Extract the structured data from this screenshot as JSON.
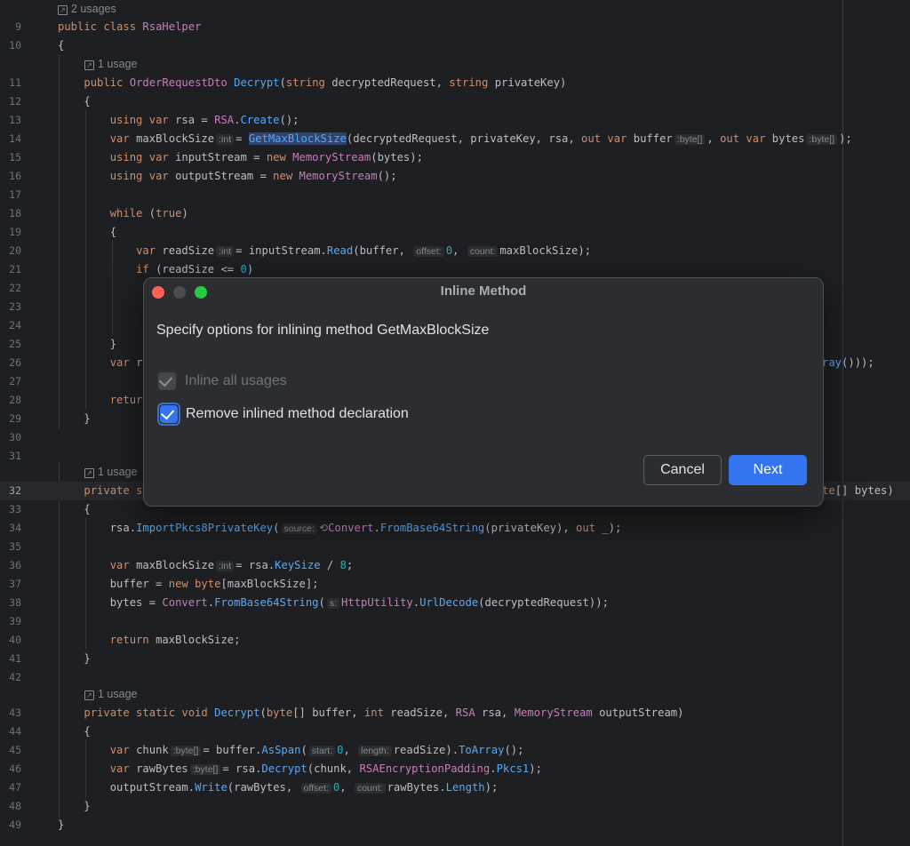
{
  "editor": {
    "usages": {
      "l9": "2 usages",
      "l11": "1 usage",
      "l32": "1 usage",
      "l43": "1 usage"
    },
    "lines": {
      "l9": "9",
      "l10": "10",
      "l11": "11",
      "l12": "12",
      "l13": "13",
      "l14": "14",
      "l15": "15",
      "l16": "16",
      "l17": "17",
      "l18": "18",
      "l19": "19",
      "l20": "20",
      "l21": "21",
      "l22": "22",
      "l23": "23",
      "l24": "24",
      "l25": "25",
      "l26": "26",
      "l27": "27",
      "l28": "28",
      "l29": "29",
      "l30": "30",
      "l31": "31",
      "l32": "32",
      "l33": "33",
      "l34": "34",
      "l35": "35",
      "l36": "36",
      "l37": "37",
      "l38": "38",
      "l39": "39",
      "l40": "40",
      "l41": "41",
      "l42": "42",
      "l43": "43",
      "l44": "44",
      "l45": "45",
      "l46": "46",
      "l47": "47",
      "l48": "48",
      "l49": "49"
    },
    "code": {
      "l9": "public class RsaHelper",
      "l10": "{",
      "l11": "    public OrderRequestDto Decrypt(string decryptedRequest, string privateKey)",
      "l12": "    {",
      "l13": "        using var rsa = RSA.Create();",
      "l14": "        var maxBlockSize:int = GetMaxBlockSize(decryptedRequest, privateKey, rsa, out var buffer:byte[], out var bytes:byte[]);",
      "l15": "        using var inputStream = new MemoryStream(bytes);",
      "l16": "        using var outputStream = new MemoryStream();",
      "l18": "        while (true)",
      "l19": "        {",
      "l20": "            var readSize:int = inputStream.Read(buffer, offset:0, count:maxBlockSize);",
      "l21": "            if (readSize <= 0)",
      "l24": "            D",
      "l25": "        }",
      "l26a": "        var r",
      "l26b": "ray()));",
      "l28": "        retur",
      "l29": "    }",
      "l32a": "    private s",
      "l32b": "te[] bytes)",
      "l33": "    {",
      "l34": "        rsa.ImportPkcs8PrivateKey(source: Convert.FromBase64String(privateKey), out _);",
      "l36": "        var maxBlockSize:int = rsa.KeySize / 8;",
      "l37": "        buffer = new byte[maxBlockSize];",
      "l38": "        bytes = Convert.FromBase64String(s: HttpUtility.UrlDecode(decryptedRequest));",
      "l40": "        return maxBlockSize;",
      "l41": "    }",
      "l43": "    private static void Decrypt(byte[] buffer, int readSize, RSA rsa, MemoryStream outputStream)",
      "l44": "    {",
      "l45": "        var chunk:byte[] = buffer.AsSpan(start:0, length:readSize).ToArray();",
      "l46": "        var rawBytes:byte[] = rsa.Decrypt(chunk, RSAEncryptionPadding.Pkcs1);",
      "l47": "        outputStream.Write(rawBytes, offset:0, count:rawBytes.Length);",
      "l48": "    }",
      "l49": "}"
    }
  },
  "dialog": {
    "title": "Inline Method",
    "description": "Specify options for inlining method GetMaxBlockSize",
    "options": [
      {
        "label": "Inline all usages",
        "checked": true,
        "enabled": false
      },
      {
        "label": "Remove inlined method declaration",
        "checked": true,
        "enabled": true
      }
    ],
    "cancel_label": "Cancel",
    "next_label": "Next"
  },
  "colors": {
    "background": "#1e1f22",
    "dialog": "#2b2d30",
    "accent": "#3574f0",
    "keyword": "#cf8e6d",
    "type": "#c77dbb",
    "method": "#56a8f5"
  }
}
